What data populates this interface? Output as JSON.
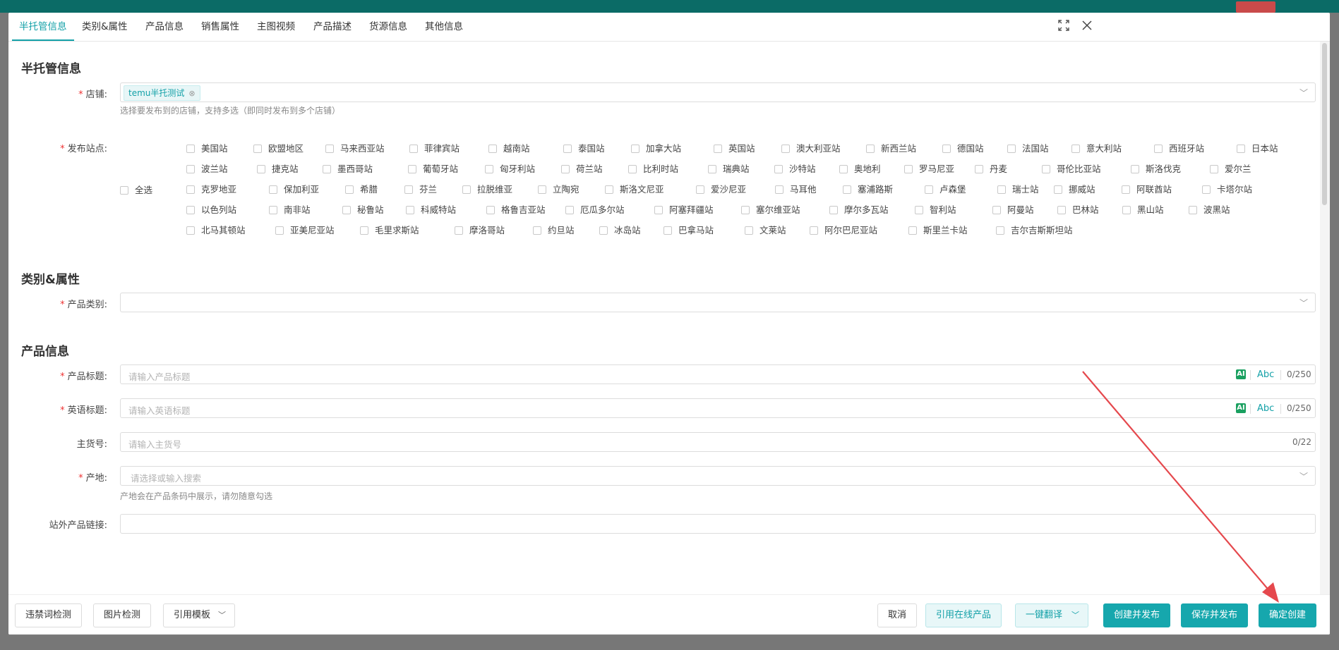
{
  "tabs": [
    "半托管信息",
    "类别&属性",
    "产品信息",
    "销售属性",
    "主图视频",
    "产品描述",
    "货源信息",
    "其他信息"
  ],
  "sections": {
    "semi": {
      "title": "半托管信息",
      "store_label": "店铺:",
      "store_tag": "temu半托测试",
      "store_hint": "选择要发布到的店铺，支持多选（即同时发布到多个店铺）",
      "sites_label": "发布站点:",
      "select_all": "全选",
      "sites": [
        [
          "美国站",
          "欧盟地区",
          "马来西亚站",
          "菲律宾站",
          "越南站",
          "泰国站",
          "加拿大站",
          "英国站",
          "澳大利亚站",
          "新西兰站",
          "德国站",
          "法国站",
          "意大利站",
          "西班牙站",
          "日本站"
        ],
        [
          "波兰站",
          "捷克站",
          "墨西哥站",
          "葡萄牙站",
          "匈牙利站",
          "荷兰站",
          "比利时站",
          "瑞典站",
          "沙特站",
          "奥地利",
          "罗马尼亚",
          "丹麦",
          "哥伦比亚站",
          "斯洛伐克",
          "爱尔兰"
        ],
        [
          "克罗地亚",
          "保加利亚",
          "希腊",
          "芬兰",
          "拉脱维亚",
          "立陶宛",
          "斯洛文尼亚",
          "爱沙尼亚",
          "马耳他",
          "塞浦路斯",
          "卢森堡",
          "瑞士站",
          "挪威站",
          "阿联酋站",
          "卡塔尔站"
        ],
        [
          "以色列站",
          "南非站",
          "秘鲁站",
          "科威特站",
          "格鲁吉亚站",
          "厄瓜多尔站",
          "阿塞拜疆站",
          "塞尔维亚站",
          "摩尔多瓦站",
          "智利站",
          "阿曼站",
          "巴林站",
          "黑山站",
          "波黑站"
        ],
        [
          "北马其顿站",
          "亚美尼亚站",
          "毛里求斯站",
          "摩洛哥站",
          "约旦站",
          "冰岛站",
          "巴拿马站",
          "文莱站",
          "阿尔巴尼亚站",
          "斯里兰卡站",
          "吉尔吉斯斯坦站"
        ]
      ]
    },
    "category": {
      "title": "类别&属性",
      "label": "产品类别:"
    },
    "product": {
      "title": "产品信息",
      "title_label": "产品标题:",
      "title_placeholder": "请输入产品标题",
      "title_count": "0/250",
      "en_label": "英语标题:",
      "en_placeholder": "请输入英语标题",
      "en_count": "0/250",
      "sku_label": "主货号:",
      "sku_placeholder": "请输入主货号",
      "sku_count": "0/22",
      "origin_label": "产地:",
      "origin_placeholder": "请选择或输入搜索",
      "origin_hint": "产地会在产品条码中展示，请勿随意勾选",
      "link_label": "站外产品链接:"
    }
  },
  "ai_text": "AI",
  "abc_text": "Abc",
  "footer": {
    "left": [
      "违禁词检测",
      "图片检测",
      "引用模板"
    ],
    "cancel": "取消",
    "cite_online": "引用在线产品",
    "translate": "一键翻译",
    "create_publish": "创建并发布",
    "save_publish": "保存并发布",
    "confirm": "确定创建"
  },
  "colors": {
    "accent": "#16a7ad",
    "required": "#ee3333",
    "arrow": "#e5484d"
  }
}
